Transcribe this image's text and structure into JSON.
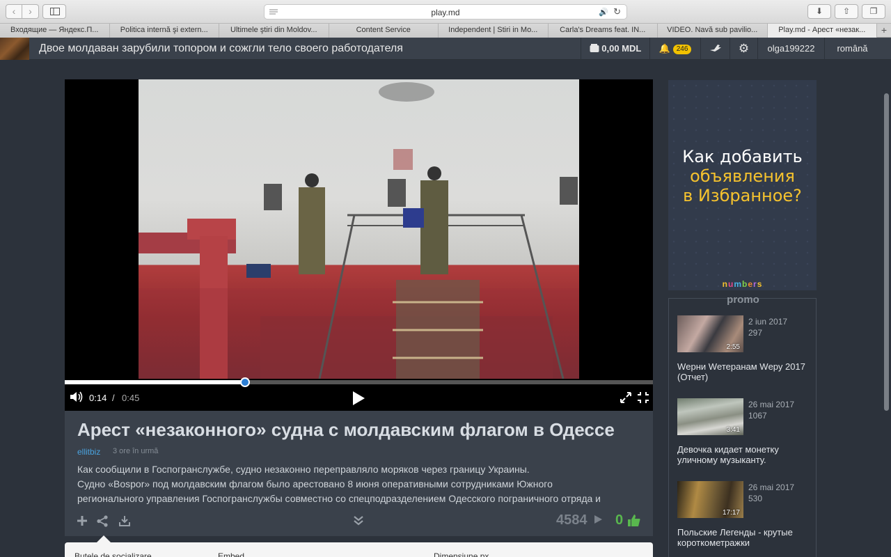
{
  "browser": {
    "url": "play.md",
    "tabs": [
      {
        "label": "Входящие — Яндекс.П..."
      },
      {
        "label": "Politica internă şi extern..."
      },
      {
        "label": "Ultimele ştiri din Moldov..."
      },
      {
        "label": "Content Service"
      },
      {
        "label": "Independent | Stiri in Mo..."
      },
      {
        "label": "Carla's Dreams feat. IN..."
      },
      {
        "label": "VIDEO. Navă sub pavilio..."
      },
      {
        "label": "Play.md - Арест «незак..."
      }
    ]
  },
  "header": {
    "title": "Двое молдаван зарубили топором и сожгли тело своего работодателя",
    "balance": "0,00 MDL",
    "notifications": "246",
    "username": "olga199222",
    "language": "română"
  },
  "player": {
    "current_time": "0:14",
    "separator": "/",
    "duration": "0:45",
    "progress": 0.306
  },
  "video": {
    "title": "Арест «незаконного» судна с молдавским флагом в Одессе",
    "author": "ellitbiz",
    "age": "3 ore în urmă",
    "description": [
      "Как сообщили в Госпогранслужбе, судно незаконно переправляло моряков через границу Украины.",
      "Судно «Bospor» под молдавским флагом было арестовано 8 июня оперативными сотрудниками Южного",
      "регионального управления Госпогранслужбы совместно со спецподразделением Одесского пограничного отряда и"
    ],
    "views": "4584",
    "likes": "0"
  },
  "share_panel": {
    "social_label": "Butele de socializare",
    "embed_label": "Embed",
    "size_label": "Dimensiune px"
  },
  "ad": {
    "line1": "Как добавить",
    "line2": "объявления",
    "line3": "в Избранное?",
    "logo": "numbers"
  },
  "promo": {
    "title": "promo",
    "items": [
      {
        "date": "2 iun 2017",
        "views": "297",
        "duration": "2:55",
        "title": "Wерни Wетеранам Wеру 2017 (Отчет)"
      },
      {
        "date": "26 mai 2017",
        "views": "1067",
        "duration": "3:41",
        "title": "Девочка кидает монетку уличному музыканту."
      },
      {
        "date": "26 mai 2017",
        "views": "530",
        "duration": "17:17",
        "title": "Польские Легенды - крутые короткометражки"
      }
    ]
  },
  "colors": {
    "accent": "#2d7fd4",
    "header_bg": "#3a414b",
    "page_bg": "#2c323b",
    "like_green": "#59b74e",
    "badge_yellow": "#f2c200"
  }
}
